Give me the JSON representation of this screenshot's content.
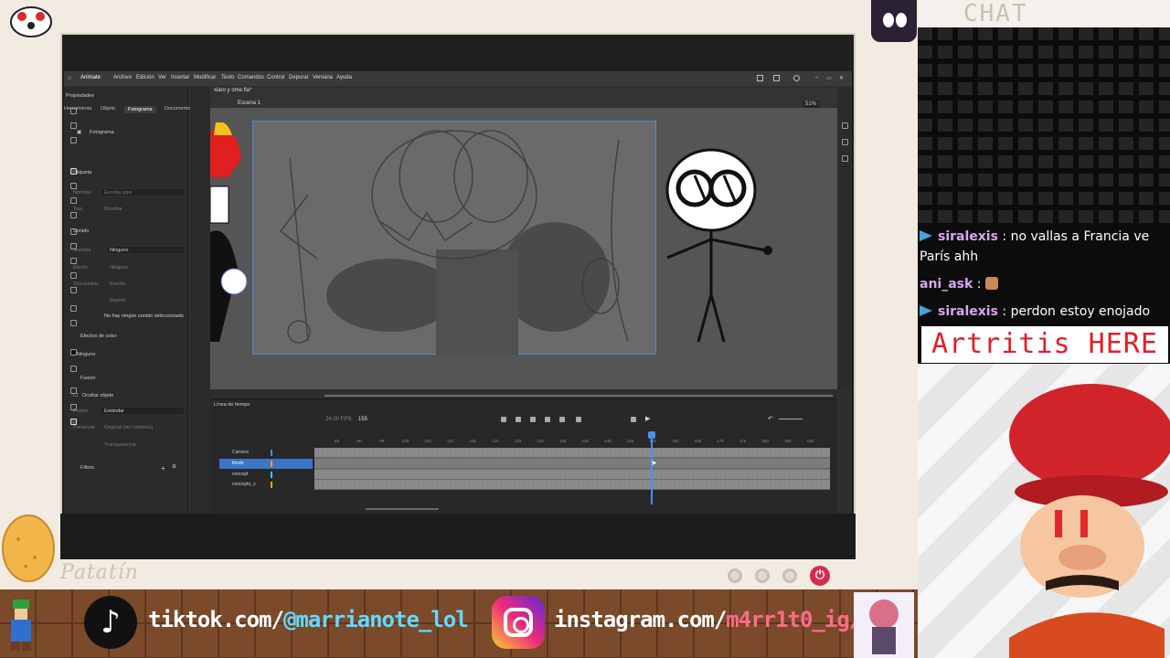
{
  "overlay": {
    "chat_title": "CHAT",
    "artritis_banner": "Artritis HERE",
    "potato_name": "Patatín",
    "tiktok": {
      "prefix": "tiktok.com/",
      "handle": "@marrianote_lol"
    },
    "instagram": {
      "prefix": "instagram.com/",
      "handle": "m4rr1t0_ig/"
    },
    "chat_messages": [
      {
        "user": "siralexis",
        "text": ": no vallas a Francia ve París ahh"
      },
      {
        "user": "ani_ask",
        "text": ":"
      },
      {
        "user": "siralexis",
        "text": ": perdon estoy enojado"
      }
    ]
  },
  "app": {
    "brand": "Animate",
    "menu": [
      "Archivo",
      "Edición",
      "Ver",
      "Insertar",
      "Modificar",
      "Texto",
      "Comandos",
      "Control",
      "Depurar",
      "Ventana",
      "Ayuda"
    ],
    "doc_tab": "xiaro y ome.fla*",
    "scene": "Escena 1",
    "zoom": "51%",
    "properties": {
      "title": "Propiedades",
      "tabs": [
        "Herramienta",
        "Objeto",
        "Fotograma",
        "Documento"
      ],
      "active_tab": "Fotograma",
      "frame_label": "Fotograma",
      "section_label": "Etiqueta",
      "label_name": "Nombre",
      "label_name_placeholder": "Escriba aquí",
      "label_type": "Tipo",
      "label_type_value": "Nombre",
      "section_sound": "Sonido",
      "sound_name": "Nombre",
      "sound_name_value": "Ninguno",
      "sound_effect": "Efecto",
      "sound_effect_value": "Ninguno",
      "sound_sync": "Sincronizar",
      "sound_sync_value": "Evento",
      "sound_repeat_value": "Repetir",
      "no_sound": "No hay ningún sonido seleccionado",
      "section_color": "Efectos de color",
      "color_value": "Ninguno",
      "section_blend": "Fusión",
      "hide_object": "Ocultar objeto",
      "blend_label": "Fusión",
      "blend_value": "Estándar",
      "preserve_label": "Preservar",
      "preserve_value": "Original (sin cambios)",
      "transparency": "Transparencia",
      "section_filters": "Filtros"
    },
    "timeline": {
      "title": "Línea de tiempo",
      "fps": "24,00 FPS",
      "current_frame": "155",
      "ticks": [
        "85",
        "90",
        "95",
        "100",
        "105",
        "110",
        "115",
        "120",
        "125",
        "130",
        "135",
        "140",
        "145",
        "150",
        "155",
        "160",
        "165",
        "170",
        "175",
        "180",
        "185",
        "190"
      ],
      "layers": [
        {
          "name": "Camera",
          "color": "#3a8fd6",
          "selected": false
        },
        {
          "name": "fondo",
          "color": "#ff9d00",
          "selected": true
        },
        {
          "name": "concept",
          "color": "#2dd0e6",
          "selected": false
        },
        {
          "name": "concepto_s",
          "color": "#ff9d00",
          "selected": false
        }
      ]
    }
  }
}
